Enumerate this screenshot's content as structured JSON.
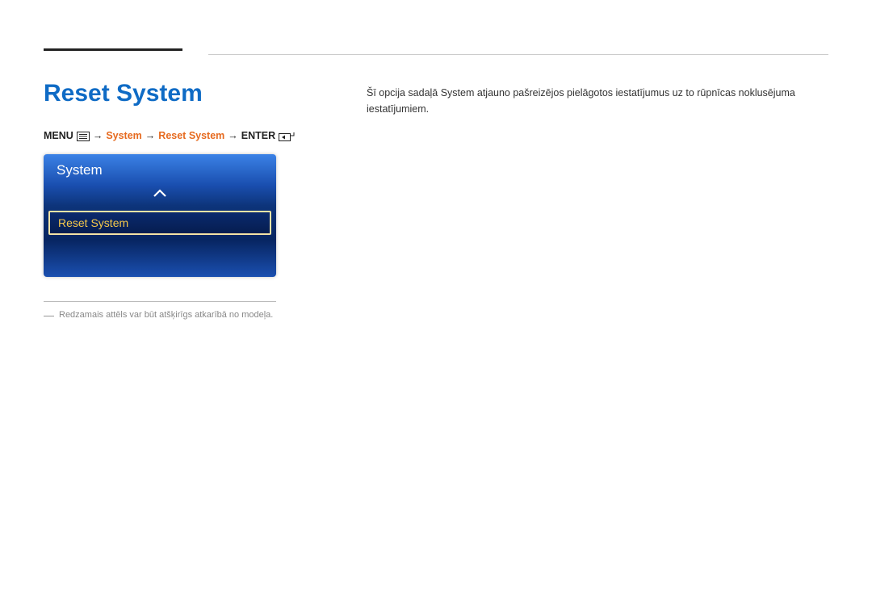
{
  "page": {
    "title": "Reset System"
  },
  "breadcrumb": {
    "menuLabel": "MENU",
    "sep": "→",
    "path1": "System",
    "path2": "Reset System",
    "enterLabel": "ENTER"
  },
  "osd": {
    "title": "System",
    "selectedItem": "Reset System"
  },
  "footnote": {
    "dash": "―",
    "text": "Redzamais attēls var būt atšķirīgs atkarībā no modeļa."
  },
  "description": {
    "text": "Šī opcija sadaļā System atjauno pašreizējos pielāgotos iestatījumus uz to rūpnīcas noklusējuma iestatījumiem."
  }
}
